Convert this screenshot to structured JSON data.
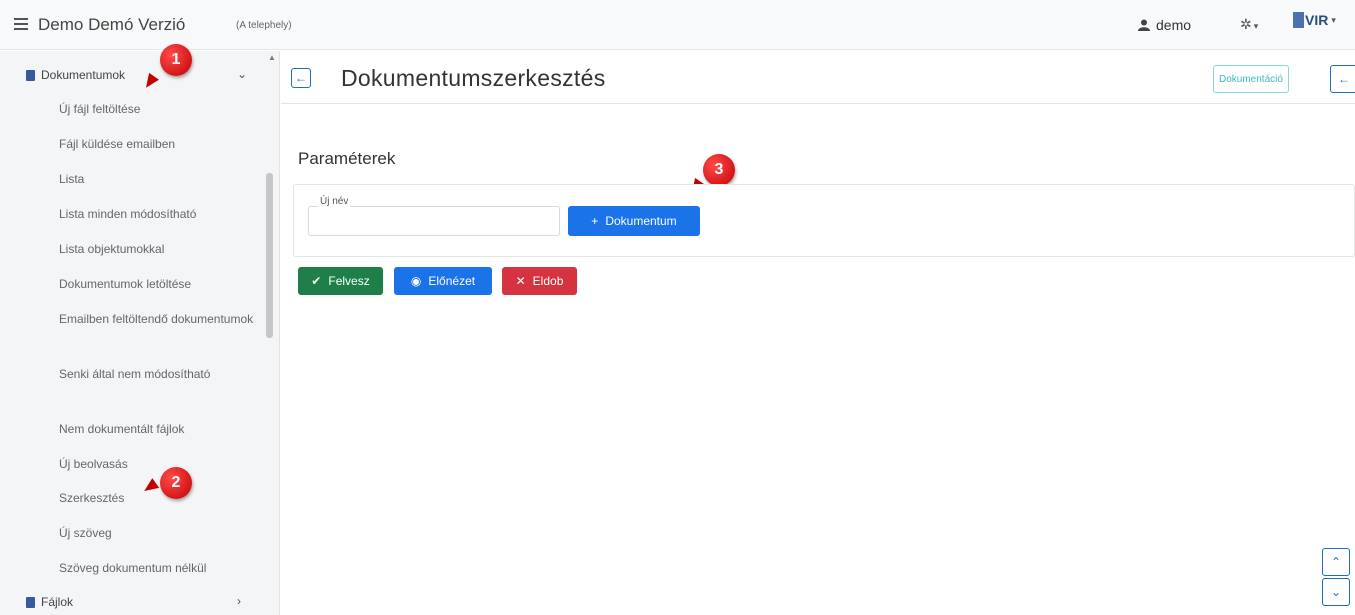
{
  "header": {
    "app_title": "Demo Demó Verzió",
    "site": "(A telephely)",
    "user": "demo",
    "logo_text": "VIR"
  },
  "sidebar": {
    "group_documents": "Dokumentumok",
    "items": [
      "Új fájl feltöltése",
      "Fájl küldése emailben",
      "Lista",
      "Lista minden módosítható",
      "Lista objektumokkal",
      "Dokumentumok letöltése",
      "Emailben feltöltendő dokumentumok",
      "Senki által nem módosítható",
      "Nem dokumentált fájlok",
      "Új beolvasás",
      "Szerkesztés",
      "Új szöveg",
      "Szöveg dokumentum nélkül"
    ],
    "group_files": "Fájlok"
  },
  "page": {
    "title": "Dokumentumszerkesztés",
    "documentation_btn": "Dokumentáció"
  },
  "params": {
    "section_title": "Paraméterek",
    "new_name_label": "Új név",
    "new_name_value": "",
    "add_document_btn": "Dokumentum"
  },
  "actions": {
    "save": "Felvesz",
    "preview": "Előnézet",
    "discard": "Eldob"
  },
  "callouts": [
    "1",
    "2",
    "3"
  ],
  "colors": {
    "primary": "#1a73e8",
    "success": "#1e8048",
    "danger": "#d63341",
    "info": "#3bb8cc",
    "callout": "#d80000"
  }
}
